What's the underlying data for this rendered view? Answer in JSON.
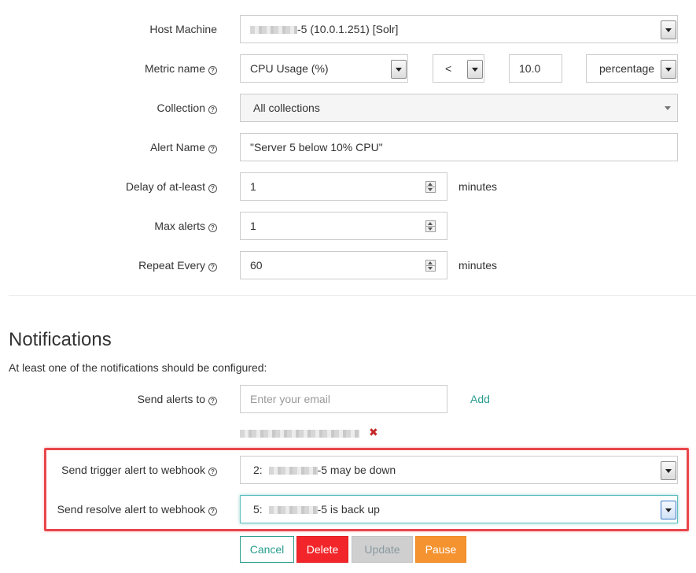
{
  "form": {
    "host_machine": {
      "label": "Host Machine",
      "value": "-5 (10.0.1.251) [Solr]"
    },
    "metric": {
      "label": "Metric name",
      "value": "CPU Usage (%)",
      "operator": "<",
      "threshold": "10.0",
      "unit": "percentage"
    },
    "collection": {
      "label": "Collection",
      "value": "All collections"
    },
    "alert_name": {
      "label": "Alert Name",
      "value": "\"Server 5 below 10% CPU\""
    },
    "delay": {
      "label": "Delay of at-least",
      "value": "1",
      "suffix": "minutes"
    },
    "max_alerts": {
      "label": "Max alerts",
      "value": "1"
    },
    "repeat_every": {
      "label": "Repeat Every",
      "value": "60",
      "suffix": "minutes"
    }
  },
  "notifications": {
    "title": "Notifications",
    "description": "At least one of the notifications should be configured:",
    "send_alerts_to": {
      "label": "Send alerts to",
      "placeholder": "Enter your email",
      "add_label": "Add"
    },
    "remove_symbol": "✖",
    "trigger_webhook": {
      "label": "Send trigger alert to webhook",
      "prefix": "2:",
      "suffix": "-5 may be down"
    },
    "resolve_webhook": {
      "label": "Send resolve alert to webhook",
      "prefix": "5:",
      "suffix": "-5 is back up"
    }
  },
  "help_glyph": "?",
  "buttons": {
    "cancel": "Cancel",
    "delete": "Delete",
    "update": "Update",
    "pause": "Pause"
  },
  "colors": {
    "accent": "#2a9d8f",
    "delete": "#f2262a",
    "pause": "#f59331",
    "highlight": "#e8474c"
  }
}
